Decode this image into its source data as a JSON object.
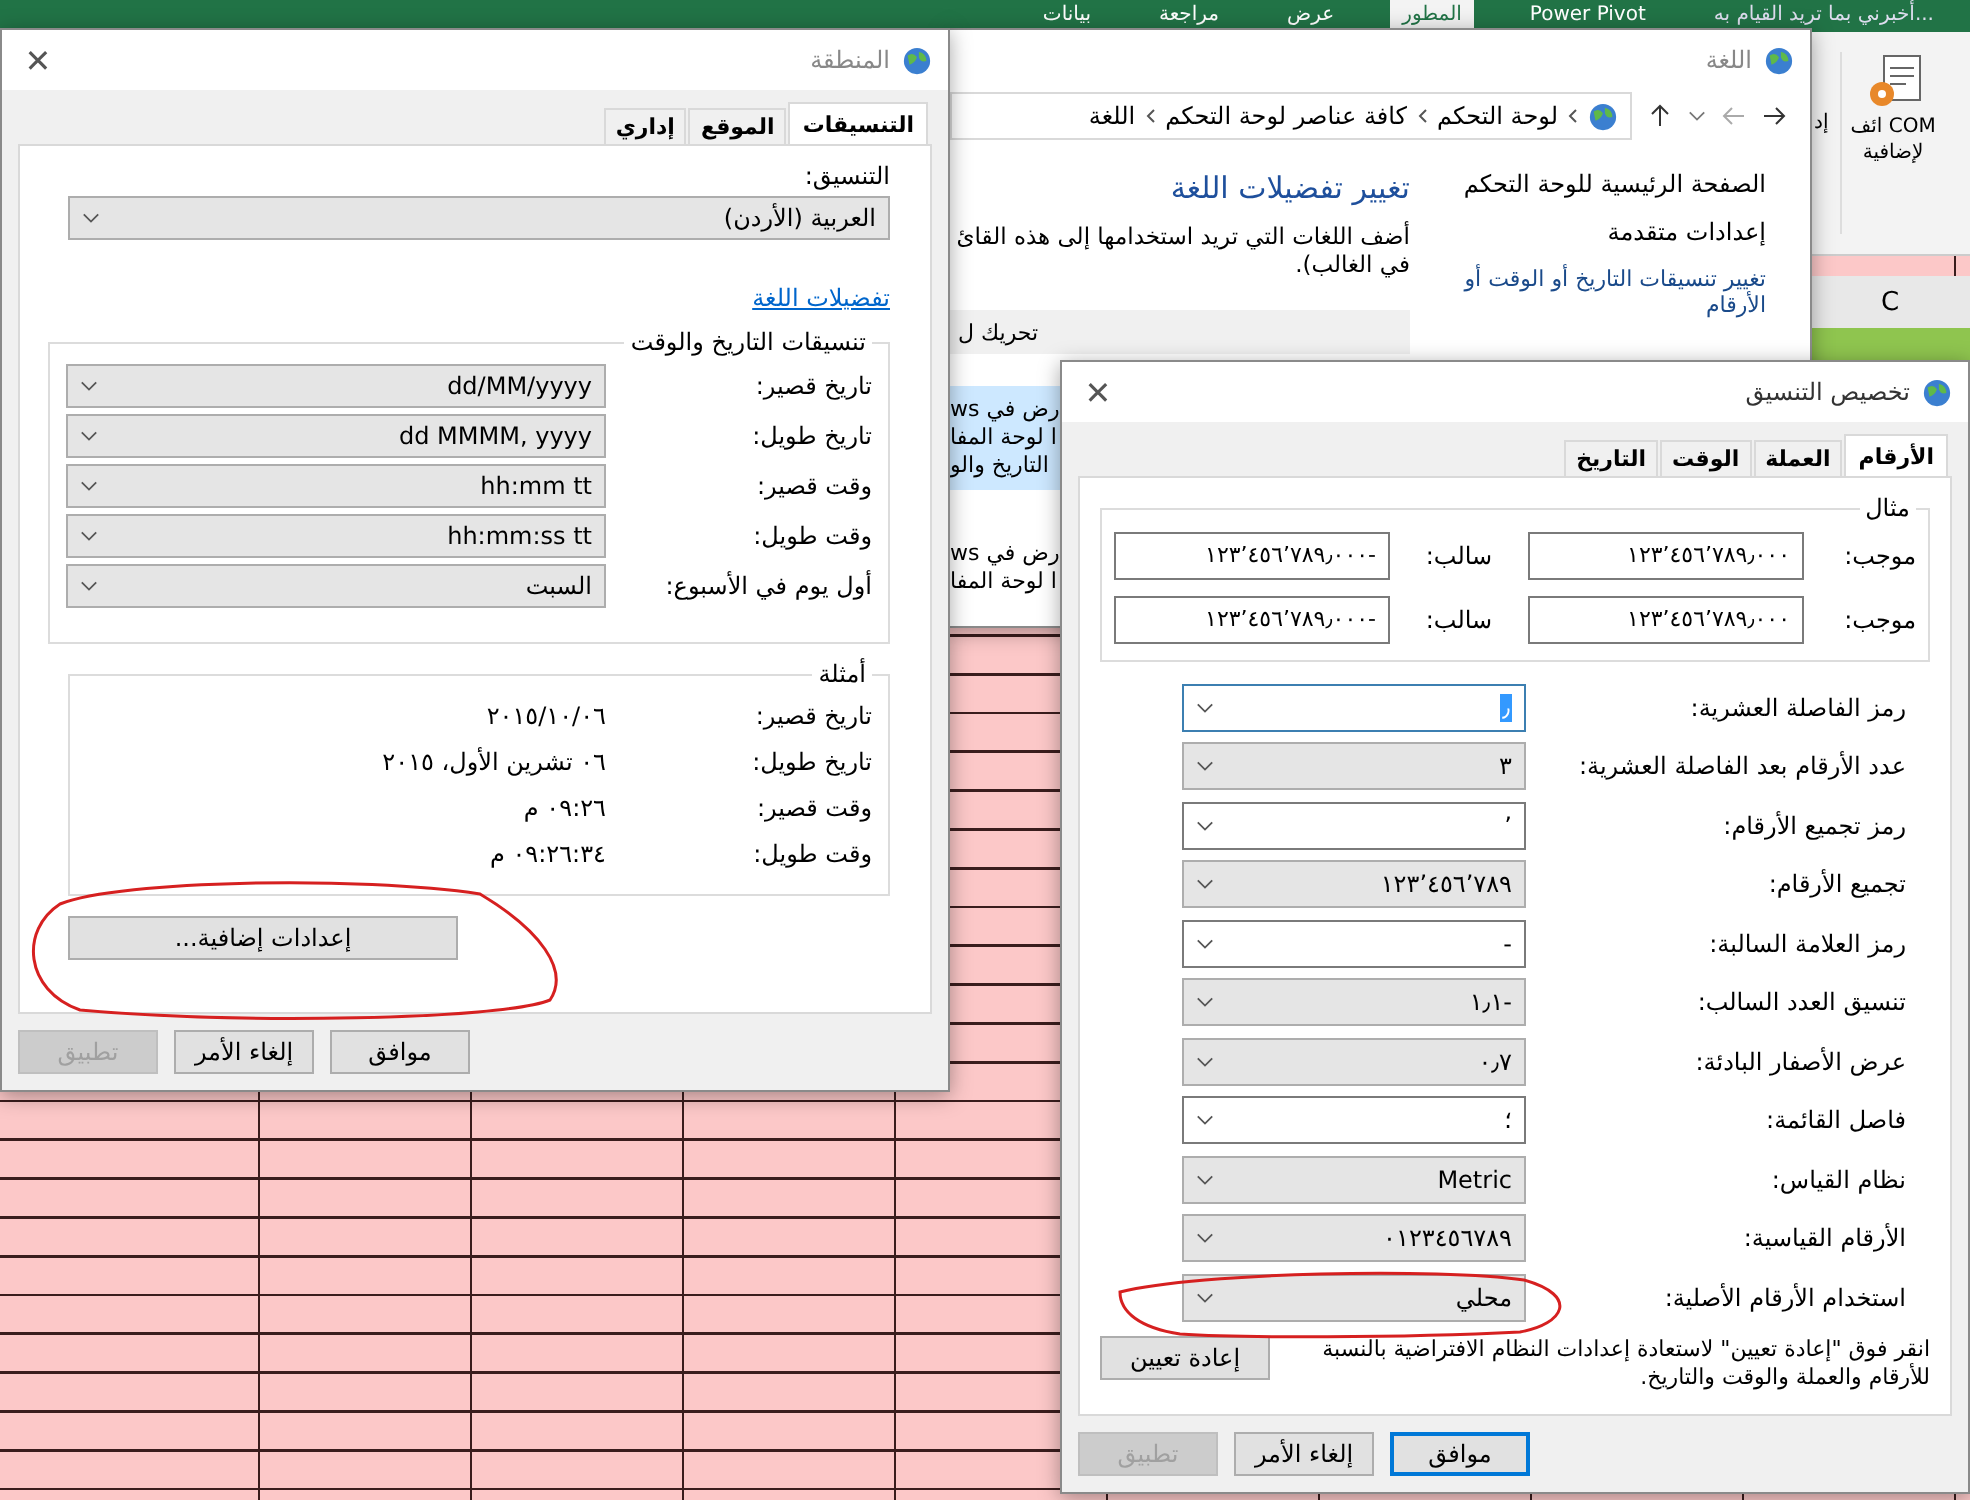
{
  "excel": {
    "ribbon_tabs": [
      {
        "label": "أخبرني بما تريد القيام به...",
        "kind": "search",
        "selected": false
      },
      {
        "label": "Power Pivot",
        "kind": "tab",
        "selected": false
      },
      {
        "label": "المطور",
        "kind": "tab",
        "selected": true
      },
      {
        "label": "عرض",
        "kind": "tab",
        "selected": false
      },
      {
        "label": "مراجعة",
        "kind": "tab",
        "selected": false
      },
      {
        "label": "بيانات",
        "kind": "tab",
        "selected": false
      }
    ],
    "ribbon_group": {
      "lines": [
        "ائف COM",
        "لإضافية"
      ]
    },
    "ribbon_cut_label": "إد",
    "column_header": "C"
  },
  "language_window": {
    "title": "اللغة",
    "breadcrumb": [
      "لوحة التحكم",
      "كافة عناصر لوحة التحكم",
      "اللغة"
    ],
    "sidebar": [
      {
        "label": "الصفحة الرئيسية للوحة التحكم"
      },
      {
        "label": "إعدادات متقدمة"
      },
      {
        "label": "تغيير تنسيقات التاريخ أو الوقت أو الأرقام"
      }
    ],
    "heading": "تغيير تفضيلات اللغة",
    "description": [
      "أضف اللغات التي تريد استخدامها إلى هذه القائ",
      "في الغالب)."
    ],
    "toolbar_fragment": "تحريك ل",
    "list": [
      {
        "lines": [
          "رض في ws",
          "ا لوحة المفا",
          "التاريخ والو"
        ],
        "selected": true
      },
      {
        "lines": [
          "رض في ws",
          "ا لوحة المفا"
        ],
        "selected": false
      }
    ]
  },
  "region_dialog": {
    "title": "المنطقة",
    "close": "✕",
    "tabs": [
      {
        "label": "التنسيقات",
        "selected": true
      },
      {
        "label": "الموقع",
        "selected": false
      },
      {
        "label": "إداري",
        "selected": false
      }
    ],
    "format_label": "التنسيق:",
    "format_value": "العربية (الأردن)",
    "link": "تفضيلات اللغة",
    "datetime_group": {
      "title": "تنسيقات التاريخ والوقت",
      "rows": [
        {
          "label": "تاريخ قصير:",
          "value": "dd/MM/yyyy"
        },
        {
          "label": "تاريخ طويل:",
          "value": "dd MMMM, yyyy"
        },
        {
          "label": "وقت قصير:",
          "value": "hh:mm tt"
        },
        {
          "label": "وقت طويل:",
          "value": "hh:mm:ss tt"
        },
        {
          "label": "أول يوم في الأسبوع:",
          "value": "السبت"
        }
      ]
    },
    "examples_group": {
      "title": "أمثلة",
      "rows": [
        {
          "label": "تاريخ قصير:",
          "value": "٢٠١٥/١٠/٠٦"
        },
        {
          "label": "تاريخ طويل:",
          "value": "٠٦ تشرين الأول، ٢٠١٥"
        },
        {
          "label": "وقت قصير:",
          "value": "٠٩:٢٦ م"
        },
        {
          "label": "وقت طويل:",
          "value": "٠٩:٢٦:٣٤ م"
        }
      ]
    },
    "additional_button": "إعدادات إضافية...",
    "buttons": [
      {
        "label": "موافق",
        "default": false,
        "disabled": false
      },
      {
        "label": "إلغاء الأمر",
        "default": false,
        "disabled": false
      },
      {
        "label": "تطبيق",
        "default": false,
        "disabled": true
      }
    ]
  },
  "customize_dialog": {
    "title": "تخصيص التنسيق",
    "close": "✕",
    "tabs": [
      {
        "label": "الأرقام",
        "selected": true
      },
      {
        "label": "العملة",
        "selected": false
      },
      {
        "label": "الوقت",
        "selected": false
      },
      {
        "label": "التاريخ",
        "selected": false
      }
    ],
    "example_group": {
      "title": "مثال",
      "rows": [
        {
          "positive_label": "موجب:",
          "positive": "١٢٣٬٤٥٦٬٧٨٩٫٠٠٠",
          "negative_label": "سالب:",
          "negative": "-١٢٣٬٤٥٦٬٧٨٩٫٠٠٠"
        },
        {
          "positive_label": "موجب:",
          "positive": "١٢٣٬٤٥٦٬٧٨٩٫٠٠٠",
          "negative_label": "سالب:",
          "negative": "-١٢٣٬٤٥٦٬٧٨٩٫٠٠٠"
        }
      ]
    },
    "settings": [
      {
        "label": "رمز الفاصلة العشرية:",
        "value": "٫",
        "editable": true,
        "focused": true
      },
      {
        "label": "عدد الأرقام بعد الفاصلة العشرية:",
        "value": "٣",
        "editable": false,
        "focused": false
      },
      {
        "label": "رمز تجميع الأرقام:",
        "value": "٬",
        "editable": true,
        "focused": false
      },
      {
        "label": "تجميع الأرقام:",
        "value": "١٢٣٬٤٥٦٬٧٨٩",
        "editable": false,
        "focused": false
      },
      {
        "label": "رمز العلامة السالبة:",
        "value": "-",
        "editable": true,
        "focused": false
      },
      {
        "label": "تنسيق العدد السالب:",
        "value": "-١٫١",
        "editable": false,
        "focused": false
      },
      {
        "label": "عرض الأصفار البادئة:",
        "value": "٠٫٧",
        "editable": false,
        "focused": false
      },
      {
        "label": "فاصل القائمة:",
        "value": "؛",
        "editable": true,
        "focused": false
      },
      {
        "label": "نظام القياس:",
        "value": "Metric",
        "editable": false,
        "focused": false
      },
      {
        "label": "الأرقام القياسية:",
        "value": "٠١٢٣٤٥٦٧٨٩",
        "editable": false,
        "focused": false
      },
      {
        "label": "استخدام الأرقام الأصلية:",
        "value": "محلي",
        "editable": false,
        "focused": false
      }
    ],
    "reset_note": "انقر فوق \"إعادة تعيين\" لاستعادة إعدادات النظام الافتراضية بالنسبة للأرقام والعملة والوقت والتاريخ.",
    "reset_button": "إعادة تعيين",
    "buttons": [
      {
        "label": "موافق",
        "default": true,
        "disabled": false
      },
      {
        "label": "إلغاء الأمر",
        "default": false,
        "disabled": false
      },
      {
        "label": "تطبيق",
        "default": false,
        "disabled": true
      }
    ]
  }
}
